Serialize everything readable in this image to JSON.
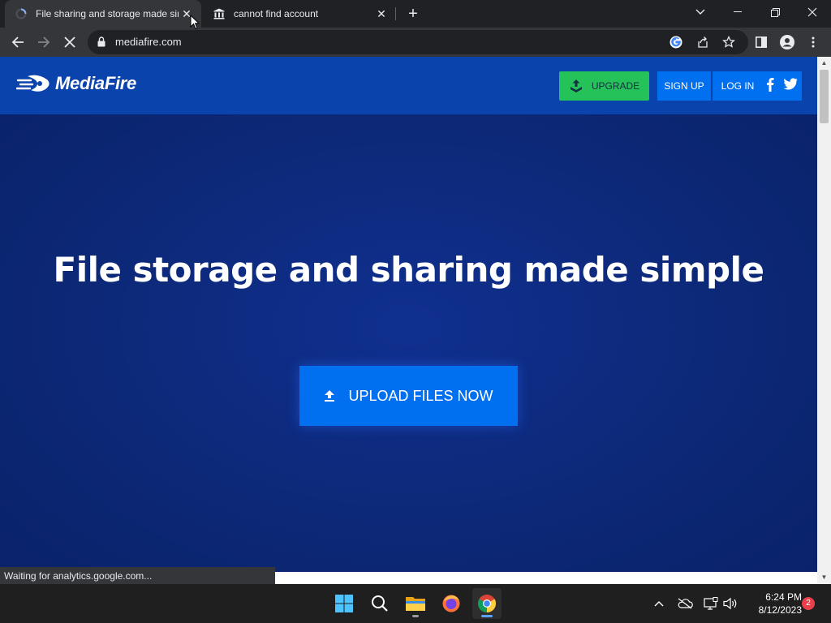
{
  "browser": {
    "tabs": [
      {
        "title": "File sharing and storage made simple",
        "active": true,
        "favicon": "loading-spinner-icon"
      },
      {
        "title": "cannot find account",
        "active": false,
        "favicon": "bank-icon"
      }
    ],
    "new_tab": "+",
    "url": "mediafire.com",
    "status_text": "Waiting for analytics.google.com..."
  },
  "site": {
    "logo_text": "MediaFire",
    "nav": {
      "upgrade": "UPGRADE",
      "signup": "SIGN UP",
      "login": "LOG IN"
    },
    "hero": {
      "title": "File storage and sharing made simple",
      "upload_button": "UPLOAD FILES NOW"
    }
  },
  "taskbar": {
    "time": "6:24 PM",
    "date": "8/12/2023",
    "notification_count": "2"
  },
  "colors": {
    "brand_blue": "#0b43ad",
    "button_blue": "#0070f0",
    "upgrade_green": "#25c25a",
    "hero_bg": "#0c2573"
  }
}
